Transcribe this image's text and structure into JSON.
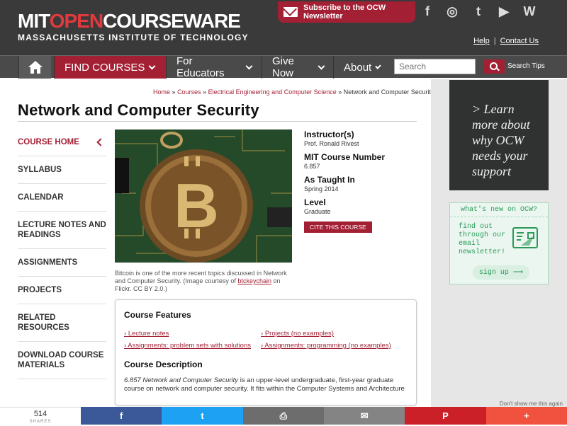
{
  "header": {
    "logo_mit": "MIT",
    "logo_open": "OPEN",
    "logo_courseware": "COURSEWARE",
    "logo_subtitle": "MASSACHUSETTS INSTITUTE OF TECHNOLOGY",
    "subscribe_label": "Subscribe to the OCW Newsletter",
    "social": [
      "f",
      "◎",
      "t",
      "▶",
      "W"
    ],
    "help_link": "Help",
    "contact_link": "Contact Us"
  },
  "nav": {
    "items": [
      {
        "label": "FIND COURSES"
      },
      {
        "label": "For Educators"
      },
      {
        "label": "Give Now"
      },
      {
        "label": "About"
      }
    ],
    "search_placeholder": "Search",
    "search_tips": "Search Tips"
  },
  "breadcrumb": {
    "home": "Home",
    "sep": "»",
    "courses": "Courses",
    "dept": "Electrical Engineering and Computer Science",
    "current": "Network and Computer Security"
  },
  "page_title": "Network and Computer Security",
  "sidebar": {
    "items": [
      {
        "label": "COURSE HOME"
      },
      {
        "label": "SYLLABUS"
      },
      {
        "label": "CALENDAR"
      },
      {
        "label": "LECTURE NOTES AND READINGS"
      },
      {
        "label": "ASSIGNMENTS"
      },
      {
        "label": "PROJECTS"
      },
      {
        "label": "RELATED RESOURCES"
      },
      {
        "label": "DOWNLOAD COURSE MATERIALS"
      }
    ]
  },
  "image": {
    "caption": "Bitcoin is one of the more recent topics discussed in Network and Computer Security. (Image courtesy of",
    "caption_link": "btckeychain",
    "caption_end": "on Flickr. CC BY 2.0.)"
  },
  "info": {
    "instructor_label": "Instructor(s)",
    "instructor": "Prof. Ronald Rivest",
    "number_label": "MIT Course Number",
    "number": "6.857",
    "taught_label": "As Taught In",
    "taught": "Spring 2014",
    "level_label": "Level",
    "level": "Graduate",
    "cite": "CITE THIS COURSE"
  },
  "features": {
    "title": "Course Features",
    "links": [
      "Lecture notes",
      "Projects (no examples)",
      "Assignments: problem sets with solutions",
      "Assignments: programming (no examples)"
    ],
    "desc_title": "Course Description",
    "desc_italic": "6.857 Network and Computer Security",
    "desc_rest": "is an upper-level undergraduate, first-year graduate course on network and computer security. It fits within the Computer Systems and Architecture"
  },
  "promo": {
    "chalk_text": "> Learn more about why OCW needs your support",
    "news_header": "what's new on OCW?",
    "news_body": "find out through our email newsletter!",
    "signup": "sign up ⟶"
  },
  "sharebar": {
    "count": "514",
    "count_label": "SHARES",
    "dont_show": "Don't show me this again",
    "buttons": [
      {
        "icon": "f",
        "color": "#3b5998"
      },
      {
        "icon": "t",
        "color": "#1da1f2"
      },
      {
        "icon": "⎙",
        "color": "#6d6d6d"
      },
      {
        "icon": "✉",
        "color": "#848484"
      },
      {
        "icon": "P",
        "color": "#cb2027"
      },
      {
        "icon": "+",
        "color": "#f0523f"
      }
    ]
  }
}
